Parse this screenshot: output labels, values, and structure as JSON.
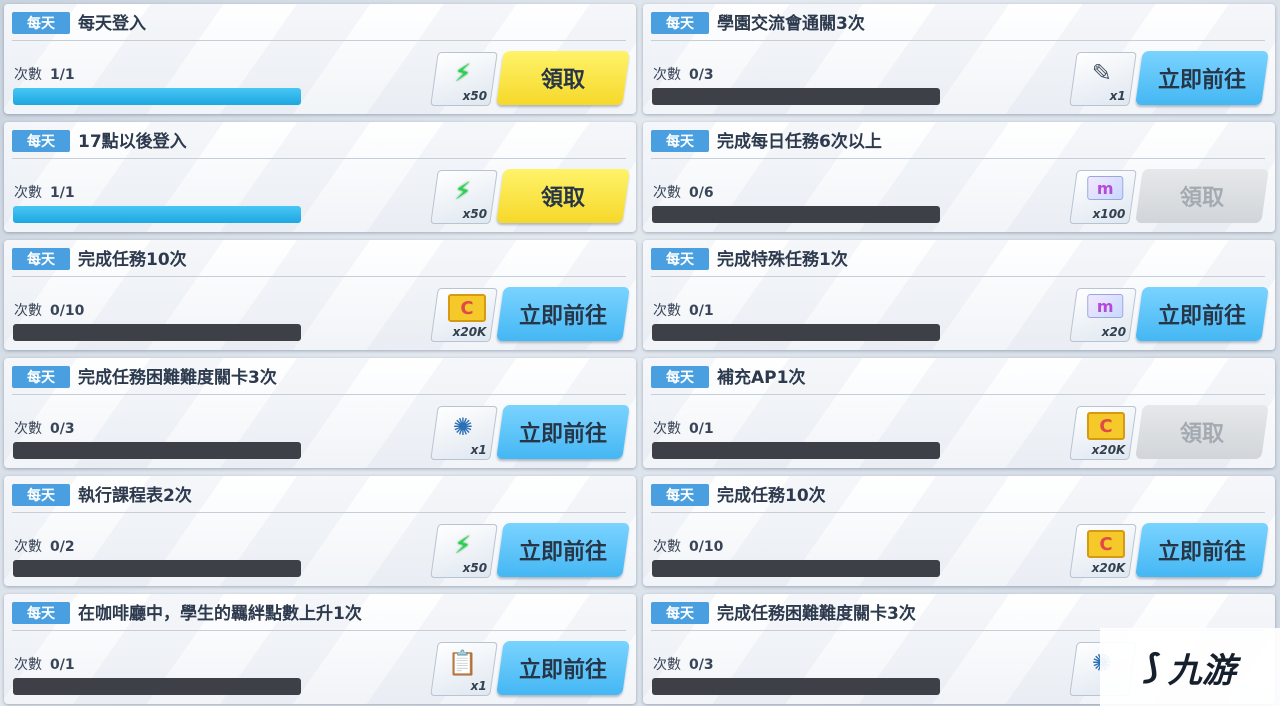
{
  "tag_label": "每天",
  "count_label": "次數",
  "left_column": [
    {
      "title": "每天登入",
      "count": "1/1",
      "progress": 1,
      "reward_icon": "energy-icon",
      "reward_glyph": "⚡",
      "reward_qty": "x50",
      "button": "領取",
      "button_style": "yellow"
    },
    {
      "title": "17點以後登入",
      "count": "1/1",
      "progress": 1,
      "reward_icon": "energy-icon",
      "reward_glyph": "⚡",
      "reward_qty": "x50",
      "button": "領取",
      "button_style": "yellow"
    },
    {
      "title": "完成任務10次",
      "count": "0/10",
      "progress": 0,
      "reward_icon": "credit-card-icon",
      "reward_glyph": "C",
      "reward_qty": "x20K",
      "button": "立即前往",
      "button_style": "blue"
    },
    {
      "title": "完成任務困難難度關卡3次",
      "count": "0/3",
      "progress": 0,
      "reward_icon": "shard-icon",
      "reward_glyph": "✺",
      "reward_qty": "x1",
      "button": "立即前往",
      "button_style": "blue"
    },
    {
      "title": "執行課程表2次",
      "count": "0/2",
      "progress": 0,
      "reward_icon": "energy-icon",
      "reward_glyph": "⚡",
      "reward_qty": "x50",
      "button": "立即前往",
      "button_style": "blue"
    },
    {
      "title": "在咖啡廳中，學生的羈絆點數上升1次",
      "count": "0/1",
      "progress": 0,
      "reward_icon": "clipboard-icon",
      "reward_glyph": "📋",
      "reward_qty": "x1",
      "button": "立即前往",
      "button_style": "blue"
    }
  ],
  "right_column": [
    {
      "title": "學園交流會通關3次",
      "count": "0/3",
      "progress": 0,
      "reward_icon": "key-icon",
      "reward_glyph": "✎",
      "reward_qty": "x1",
      "button": "立即前往",
      "button_style": "blue"
    },
    {
      "title": "完成每日任務6次以上",
      "count": "0/6",
      "progress": 0,
      "reward_icon": "pyroxene-ticket-icon",
      "reward_glyph": "m",
      "reward_qty": "x100",
      "button": "領取",
      "button_style": "gray"
    },
    {
      "title": "完成特殊任務1次",
      "count": "0/1",
      "progress": 0,
      "reward_icon": "pyroxene-ticket-icon",
      "reward_glyph": "m",
      "reward_qty": "x20",
      "button": "立即前往",
      "button_style": "blue"
    },
    {
      "title": "補充AP1次",
      "count": "0/1",
      "progress": 0,
      "reward_icon": "credit-card-icon",
      "reward_glyph": "C",
      "reward_qty": "x20K",
      "button": "領取",
      "button_style": "gray"
    },
    {
      "title": "完成任務10次",
      "count": "0/10",
      "progress": 0,
      "reward_icon": "credit-card-icon",
      "reward_glyph": "C",
      "reward_qty": "x20K",
      "button": "立即前往",
      "button_style": "blue"
    },
    {
      "title": "完成任務困難難度關卡3次",
      "count": "0/3",
      "progress": 0,
      "reward_icon": "shard-icon",
      "reward_glyph": "✺",
      "reward_qty": "",
      "button": "",
      "button_style": "blue"
    }
  ],
  "watermark": {
    "logo_glyph": "⟆",
    "text": "九游"
  }
}
